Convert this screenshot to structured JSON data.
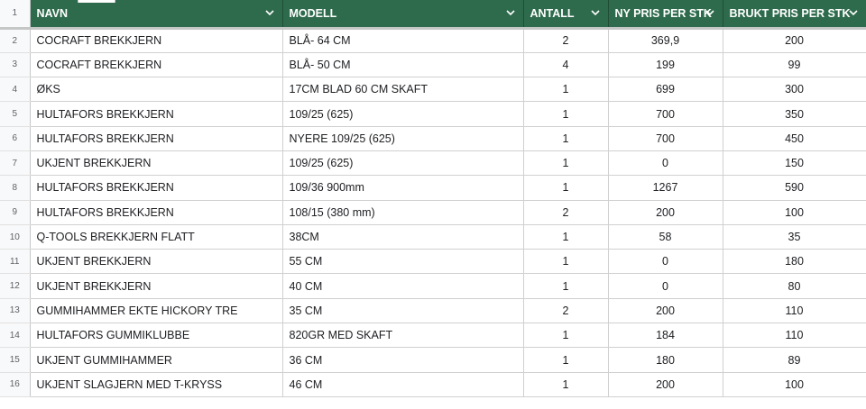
{
  "header": {
    "row_number": "1",
    "columns": [
      {
        "label": "NAVN"
      },
      {
        "label": "MODELL"
      },
      {
        "label": "ANTALL"
      },
      {
        "label": "NY PRIS PER STK"
      },
      {
        "label": "BRUKT PRIS PER STK"
      }
    ]
  },
  "rows": [
    {
      "n": "2",
      "navn": "COCRAFT BREKKJERN",
      "modell": "BLÅ- 64 CM",
      "antall": "2",
      "ny": "369,9",
      "brukt": "200"
    },
    {
      "n": "3",
      "navn": "COCRAFT BREKKJERN",
      "modell": "BLÅ- 50 CM",
      "antall": "4",
      "ny": "199",
      "brukt": "99"
    },
    {
      "n": "4",
      "navn": "ØKS",
      "modell": "17CM BLAD 60 CM SKAFT",
      "antall": "1",
      "ny": "699",
      "brukt": "300"
    },
    {
      "n": "5",
      "navn": "HULTAFORS BREKKJERN",
      "modell": "109/25 (625)",
      "antall": "1",
      "ny": "700",
      "brukt": "350"
    },
    {
      "n": "6",
      "navn": "HULTAFORS BREKKJERN",
      "modell": "NYERE 109/25 (625)",
      "antall": "1",
      "ny": "700",
      "brukt": "450"
    },
    {
      "n": "7",
      "navn": "UKJENT BREKKJERN",
      "modell": "109/25 (625)",
      "antall": "1",
      "ny": "0",
      "brukt": "150"
    },
    {
      "n": "8",
      "navn": "HULTAFORS BREKKJERN",
      "modell": "109/36 900mm",
      "antall": "1",
      "ny": "1267",
      "brukt": "590"
    },
    {
      "n": "9",
      "navn": "HULTAFORS BREKKJERN",
      "modell": "108/15  (380 mm)",
      "antall": "2",
      "ny": "200",
      "brukt": "100"
    },
    {
      "n": "10",
      "navn": "Q-TOOLS BREKKJERN FLATT",
      "modell": "38CM",
      "antall": "1",
      "ny": "58",
      "brukt": "35"
    },
    {
      "n": "11",
      "navn": "UKJENT BREKKJERN",
      "modell": "55 CM",
      "antall": "1",
      "ny": "0",
      "brukt": "180"
    },
    {
      "n": "12",
      "navn": "UKJENT BREKKJERN",
      "modell": "40 CM",
      "antall": "1",
      "ny": "0",
      "brukt": "80"
    },
    {
      "n": "13",
      "navn": "GUMMIHAMMER EKTE HICKORY TRE",
      "modell": "35 CM",
      "antall": "2",
      "ny": "200",
      "brukt": "110"
    },
    {
      "n": "14",
      "navn": "HULTAFORS GUMMIKLUBBE",
      "modell": "820GR MED SKAFT",
      "antall": "1",
      "ny": "184",
      "brukt": "110"
    },
    {
      "n": "15",
      "navn": "UKJENT GUMMIHAMMER",
      "modell": "36 CM",
      "antall": "1",
      "ny": "180",
      "brukt": "89"
    },
    {
      "n": "16",
      "navn": "UKJENT SLAGJERN MED T-KRYSS",
      "modell": "46 CM",
      "antall": "1",
      "ny": "200",
      "brukt": "100"
    }
  ],
  "colors": {
    "header_bg": "#2e6b4c",
    "header_text": "#ffffff",
    "grid": "#d0d0d0"
  }
}
